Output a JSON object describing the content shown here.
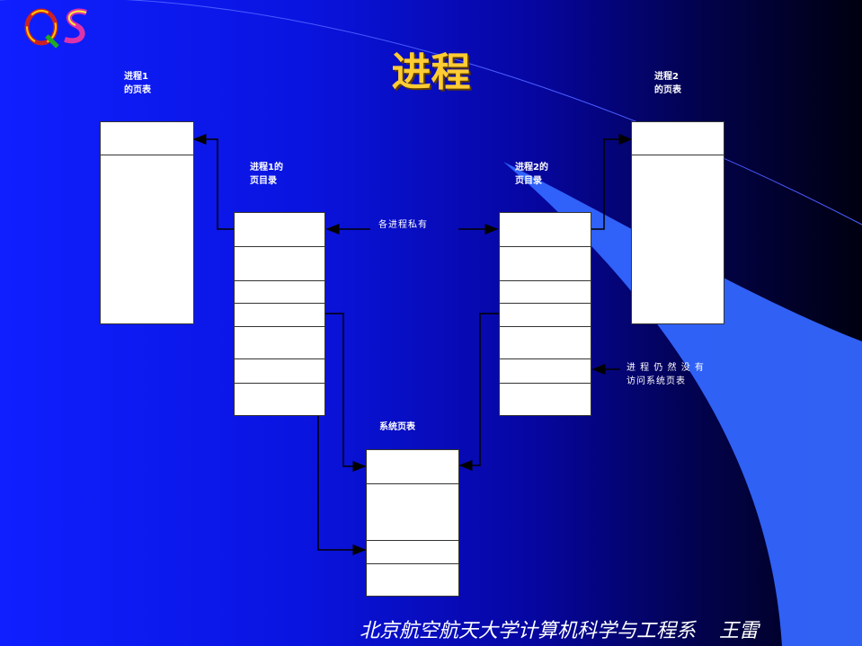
{
  "title": "进程",
  "labels": {
    "p1_page_table": [
      "进程1",
      "的页表"
    ],
    "p2_page_table": [
      "进程2",
      "的页表"
    ],
    "p1_page_dir": [
      "进程1的",
      "页目录"
    ],
    "p2_page_dir": [
      "进程2的",
      "页目录"
    ],
    "system_page_table": "系统页表",
    "private_note": "各进程私有",
    "access_note": [
      "进 程 仍 然 没 有",
      "访问系统页表"
    ]
  },
  "footer": {
    "org": "北京航空航天大学计算机科学与工程系",
    "author": "王雷"
  },
  "colors": {
    "title": "#ffcc33",
    "background_left": "#0f1fff",
    "background_right": "#000010",
    "accent_swoosh": "#3366ff"
  }
}
